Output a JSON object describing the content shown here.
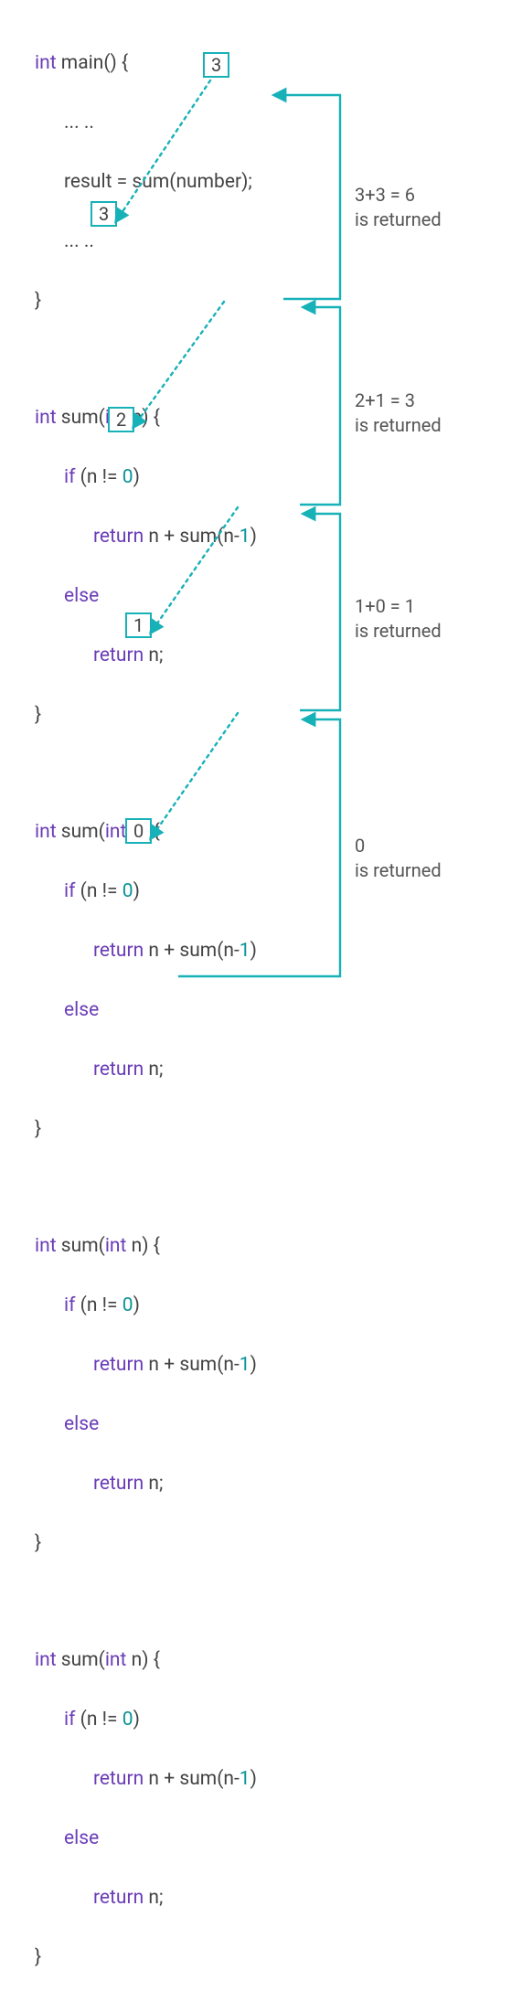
{
  "colors": {
    "keyword": "#6b3db7",
    "number": "#0a9396",
    "arrow": "#17b1b8",
    "text": "#444"
  },
  "boxes": {
    "top": "3",
    "call1": "3",
    "call2": "2",
    "call3": "1",
    "call4": "0"
  },
  "annotations": {
    "a1_l1": "3+3 = 6",
    "a1_l2": "is returned",
    "a2_l1": "2+1 = 3",
    "a2_l2": "is returned",
    "a3_l1": "1+0 = 1",
    "a3_l2": "is returned",
    "a4_l1": "0",
    "a4_l2": "is returned"
  },
  "code": {
    "int": "int",
    "main": "main() {",
    "dots": "... ..",
    "result_lhs": "result = ",
    "result_rhs": "sum",
    "result_arg": "(number);",
    "close": "}",
    "sum_sig_pre": "sum(",
    "sum_sig_int": "int",
    "sum_sig_post": " n) {",
    "if_pre": "if",
    "if_cond_open": " (n != ",
    "if_cond_zero": "0",
    "if_cond_close": ")",
    "ret_open": "return",
    "ret_expr_pre": " n + sum(n-",
    "ret_expr_one": "1",
    "ret_expr_close": ")",
    "else": "else",
    "ret_n": " n;"
  }
}
